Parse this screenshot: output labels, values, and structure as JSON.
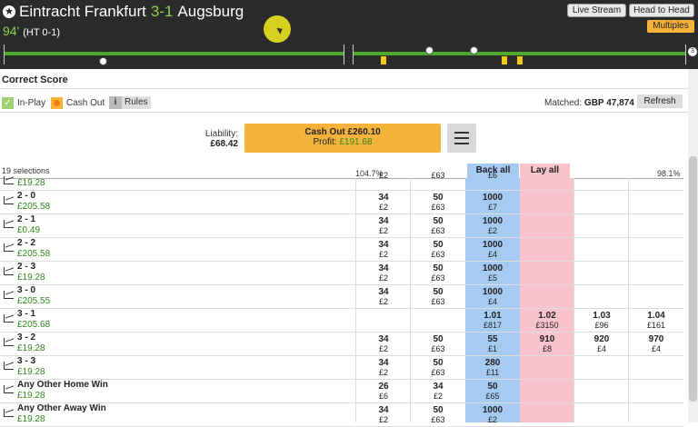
{
  "header": {
    "home": "Eintracht Frankfurt",
    "score": "3-1",
    "away": "Augsburg",
    "minute": "94'",
    "half_time": "(HT 0-1)",
    "live_stream_label": "Live Stream",
    "head_to_head_label": "Head to Head",
    "multiples_label": "Multiples",
    "timeline_end_badge": "3"
  },
  "market": {
    "title": "Correct Score",
    "in_play_label": "In-Play",
    "cash_out_label": "Cash Out",
    "rules_label": "Rules",
    "rules_icon_glyph": "i",
    "matched_label": "Matched:",
    "matched_value": "GBP 47,874",
    "refresh_label": "Refresh"
  },
  "cashout": {
    "liability_label": "Liability:",
    "liability_value": "£68.42",
    "button_title": "Cash Out £260.10",
    "profit_label": "Profit:",
    "profit_value": "£191.68"
  },
  "table": {
    "selections": "19 selections",
    "back_pct": "104.7%",
    "lay_pct": "98.1%",
    "back_all_label": "Back all",
    "lay_all_label": "Lay all",
    "rows": [
      {
        "name": "",
        "pl": "£19.28",
        "c1": [
          "",
          "£2"
        ],
        "c2": [
          "",
          "£63"
        ],
        "c3": [
          "",
          "£6"
        ],
        "c4": [
          "",
          ""
        ],
        "c5": [
          "",
          ""
        ],
        "c6": [
          "",
          ""
        ]
      },
      {
        "name": "2 - 0",
        "pl": "£205.58",
        "c1": [
          "34",
          "£2"
        ],
        "c2": [
          "50",
          "£63"
        ],
        "c3": [
          "1000",
          "£7"
        ],
        "c4": [
          "",
          ""
        ],
        "c5": [
          "",
          ""
        ],
        "c6": [
          "",
          ""
        ]
      },
      {
        "name": "2 - 1",
        "pl": "£0.49",
        "c1": [
          "34",
          "£2"
        ],
        "c2": [
          "50",
          "£63"
        ],
        "c3": [
          "1000",
          "£2"
        ],
        "c4": [
          "",
          ""
        ],
        "c5": [
          "",
          ""
        ],
        "c6": [
          "",
          ""
        ]
      },
      {
        "name": "2 - 2",
        "pl": "£205.58",
        "c1": [
          "34",
          "£2"
        ],
        "c2": [
          "50",
          "£63"
        ],
        "c3": [
          "1000",
          "£4"
        ],
        "c4": [
          "",
          ""
        ],
        "c5": [
          "",
          ""
        ],
        "c6": [
          "",
          ""
        ]
      },
      {
        "name": "2 - 3",
        "pl": "£19.28",
        "c1": [
          "34",
          "£2"
        ],
        "c2": [
          "50",
          "£63"
        ],
        "c3": [
          "1000",
          "£5"
        ],
        "c4": [
          "",
          ""
        ],
        "c5": [
          "",
          ""
        ],
        "c6": [
          "",
          ""
        ]
      },
      {
        "name": "3 - 0",
        "pl": "£205.55",
        "c1": [
          "34",
          "£2"
        ],
        "c2": [
          "50",
          "£63"
        ],
        "c3": [
          "1000",
          "£4"
        ],
        "c4": [
          "",
          ""
        ],
        "c5": [
          "",
          ""
        ],
        "c6": [
          "",
          ""
        ]
      },
      {
        "name": "3 - 1",
        "pl": "£205.68",
        "c1": [
          "",
          ""
        ],
        "c2": [
          "",
          ""
        ],
        "c3": [
          "1.01",
          "£817"
        ],
        "c4": [
          "1.02",
          "£3150"
        ],
        "c5": [
          "1.03",
          "£96"
        ],
        "c6": [
          "1.04",
          "£161"
        ]
      },
      {
        "name": "3 - 2",
        "pl": "£19.28",
        "c1": [
          "34",
          "£2"
        ],
        "c2": [
          "50",
          "£63"
        ],
        "c3": [
          "55",
          "£1"
        ],
        "c4": [
          "910",
          "£8"
        ],
        "c5": [
          "920",
          "£4"
        ],
        "c6": [
          "970",
          "£4"
        ]
      },
      {
        "name": "3 - 3",
        "pl": "£19.28",
        "c1": [
          "34",
          "£2"
        ],
        "c2": [
          "50",
          "£63"
        ],
        "c3": [
          "280",
          "£11"
        ],
        "c4": [
          "",
          ""
        ],
        "c5": [
          "",
          ""
        ],
        "c6": [
          "",
          ""
        ]
      },
      {
        "name": "Any Other Home Win",
        "pl": "£19.28",
        "c1": [
          "26",
          "£6"
        ],
        "c2": [
          "34",
          "£2"
        ],
        "c3": [
          "50",
          "£65"
        ],
        "c4": [
          "",
          ""
        ],
        "c5": [
          "",
          ""
        ],
        "c6": [
          "",
          ""
        ]
      },
      {
        "name": "Any Other Away Win",
        "pl": "£19.28",
        "c1": [
          "34",
          "£2"
        ],
        "c2": [
          "50",
          "£63"
        ],
        "c3": [
          "1000",
          "£2"
        ],
        "c4": [
          "",
          ""
        ],
        "c5": [
          "",
          ""
        ],
        "c6": [
          "",
          ""
        ]
      }
    ]
  },
  "colors": {
    "back": "#a6cbf2",
    "lay": "#f9c3cd",
    "cashout": "#f6b33c",
    "live_green": "#8ed14b"
  }
}
